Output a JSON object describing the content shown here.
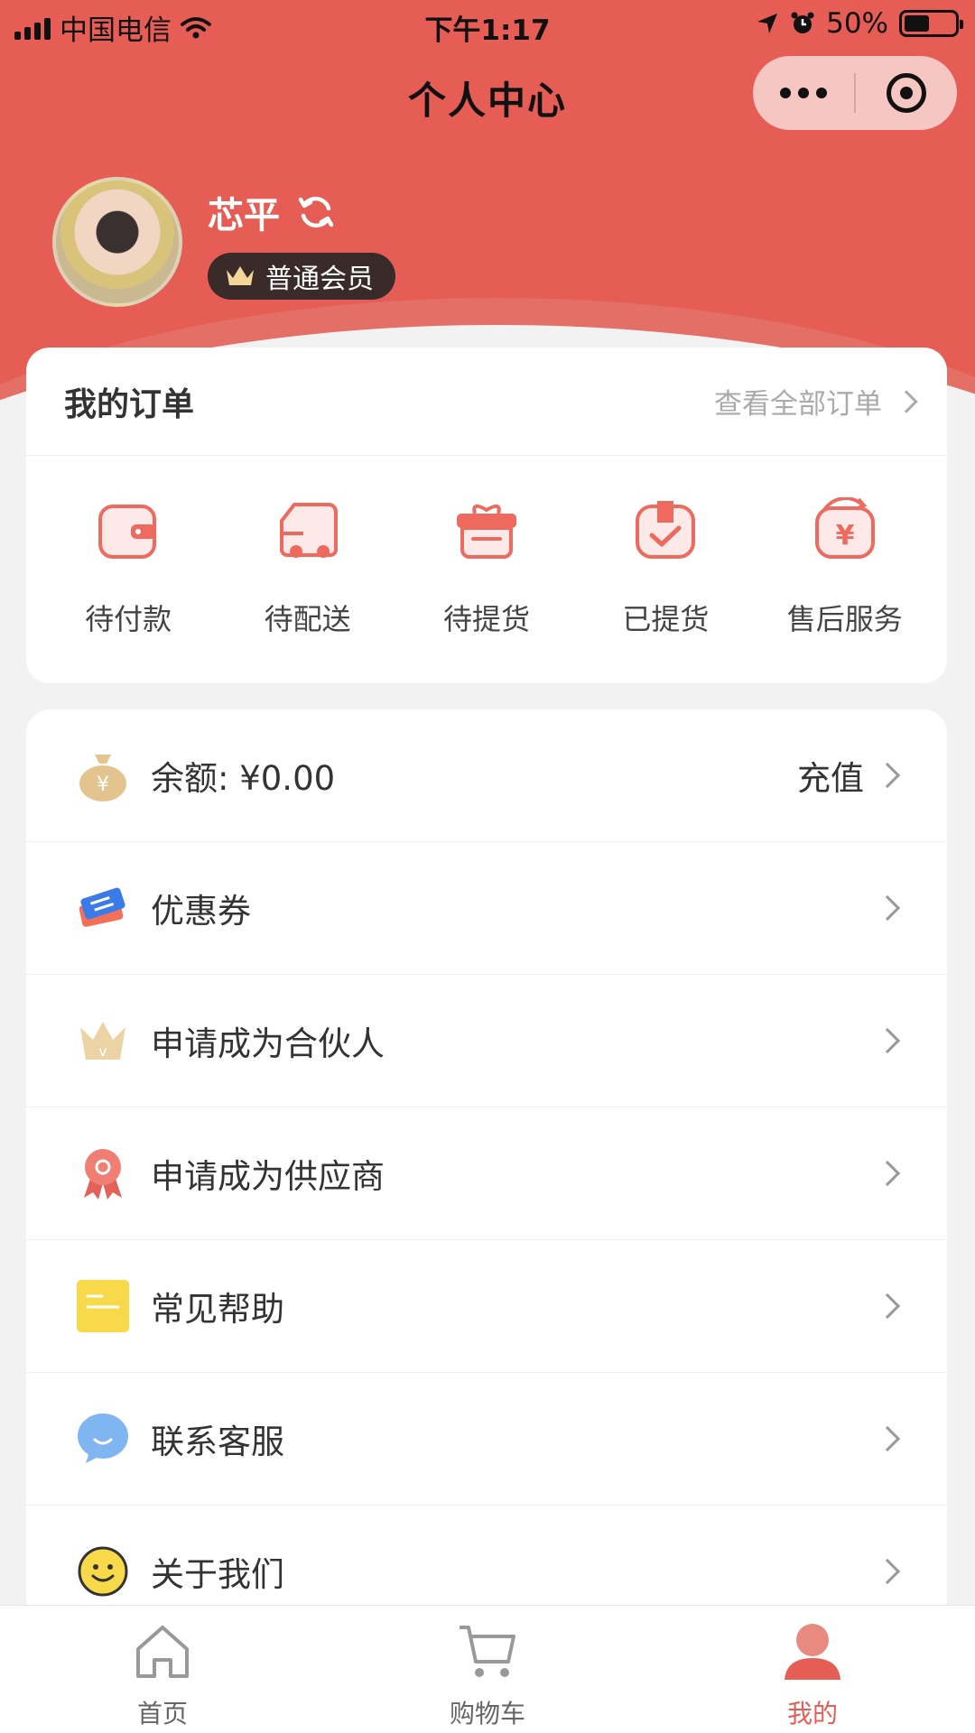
{
  "status_bar": {
    "carrier": "中国电信",
    "time": "下午1:17",
    "battery": "50%"
  },
  "nav": {
    "title": "个人中心"
  },
  "profile": {
    "name": "芯平",
    "member_level": "普通会员"
  },
  "orders": {
    "title": "我的订单",
    "view_all": "查看全部订单",
    "items": [
      {
        "label": "待付款",
        "icon": "wallet-icon"
      },
      {
        "label": "待配送",
        "icon": "delivery-truck-icon"
      },
      {
        "label": "待提货",
        "icon": "gift-box-icon"
      },
      {
        "label": "已提货",
        "icon": "checked-box-icon"
      },
      {
        "label": "售后服务",
        "icon": "yuan-refund-icon"
      }
    ]
  },
  "menu": {
    "balance_label": "余额: ¥0.00",
    "recharge": "充值",
    "items": [
      {
        "label": "优惠券",
        "icon": "coupon-icon"
      },
      {
        "label": "申请成为合伙人",
        "icon": "crown-icon"
      },
      {
        "label": "申请成为供应商",
        "icon": "ribbon-badge-icon"
      },
      {
        "label": "常见帮助",
        "icon": "note-icon"
      },
      {
        "label": "联系客服",
        "icon": "chat-bubble-icon"
      },
      {
        "label": "关于我们",
        "icon": "smiley-icon"
      }
    ]
  },
  "tabbar": {
    "items": [
      {
        "label": "首页",
        "icon": "home-icon",
        "active": false
      },
      {
        "label": "购物车",
        "icon": "cart-icon",
        "active": false
      },
      {
        "label": "我的",
        "icon": "user-icon",
        "active": true
      }
    ]
  },
  "colors": {
    "brand": "#e65d55",
    "badge_bg": "#3a2a2a",
    "accent_gold": "#e3c48e"
  }
}
